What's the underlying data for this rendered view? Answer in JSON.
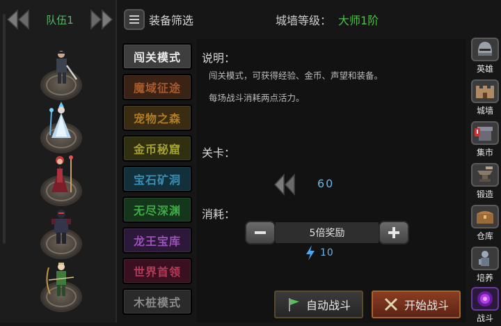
{
  "team": {
    "label": "队伍1"
  },
  "top_bar": {
    "filter_label": "装备筛选",
    "wall_label": "城墙等级：",
    "wall_value": "大师1阶"
  },
  "modes": [
    {
      "label": "闯关模式",
      "bg": "#3e3e3e",
      "fg": "#ececec"
    },
    {
      "label": "魔域征途",
      "bg": "#3a2214",
      "fg": "#a85a2e"
    },
    {
      "label": "宠物之森",
      "bg": "#3a2c12",
      "fg": "#b07c28"
    },
    {
      "label": "金币秘窟",
      "bg": "#303010",
      "fg": "#a4a032"
    },
    {
      "label": "宝石矿洞",
      "bg": "#12303c",
      "fg": "#3b8fb4"
    },
    {
      "label": "无尽深渊",
      "bg": "#14361a",
      "fg": "#3eaa46"
    },
    {
      "label": "龙王宝库",
      "bg": "#2c1838",
      "fg": "#9a52b8"
    },
    {
      "label": "世界首领",
      "bg": "#3a1020",
      "fg": "#b43a58"
    },
    {
      "label": "木桩模式",
      "bg": "#2a2a2a",
      "fg": "#8a8a8a"
    }
  ],
  "info": {
    "desc_title": "说明：",
    "desc_line1": "闯关模式，可获得经验、金币、声望和装备。",
    "desc_line2": "每场战斗消耗两点活力。",
    "stage_title": "关卡：",
    "stage_value": "60",
    "cost_title": "消耗：",
    "reward_label": "5倍奖励",
    "energy_value": "10"
  },
  "actions": {
    "auto_label": "自动战斗",
    "start_label": "开始战斗"
  },
  "menu": [
    {
      "label": "英雄",
      "icon": "helmet-icon"
    },
    {
      "label": "城墙",
      "icon": "wall-icon"
    },
    {
      "label": "集市",
      "icon": "market-icon"
    },
    {
      "label": "锻造",
      "icon": "anvil-icon"
    },
    {
      "label": "仓库",
      "icon": "chest-icon"
    },
    {
      "label": "培养",
      "icon": "training-icon"
    },
    {
      "label": "战斗",
      "icon": "portal-icon"
    }
  ]
}
